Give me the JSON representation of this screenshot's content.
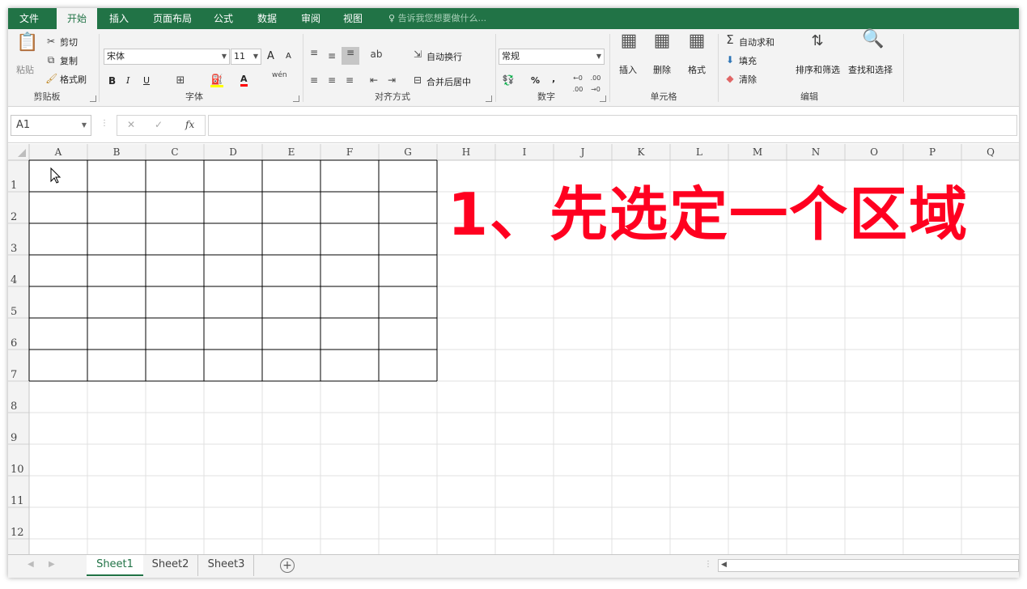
{
  "menu": {
    "tabs": [
      "文件",
      "开始",
      "插入",
      "页面布局",
      "公式",
      "数据",
      "审阅",
      "视图"
    ],
    "active": "开始",
    "tell_me": "告诉我您想要做什么..."
  },
  "ribbon": {
    "clipboard": {
      "paste": "粘贴",
      "cut": "剪切",
      "copy": "复制",
      "format_painter": "格式刷",
      "label": "剪贴板"
    },
    "font": {
      "name": "宋体",
      "size": "11",
      "bold": "B",
      "italic": "I",
      "underline": "U",
      "grow": "A",
      "shrink": "A",
      "font_color": "A",
      "phonetic": "wén",
      "label": "字体"
    },
    "alignment": {
      "wrap": "自动换行",
      "merge": "合并后居中",
      "label": "对齐方式"
    },
    "number": {
      "format": "常规",
      "percent": "%",
      "comma": ",",
      "label": "数字"
    },
    "cells": {
      "insert": "插入",
      "delete": "删除",
      "format": "格式",
      "label": "单元格"
    },
    "editing": {
      "autosum": "自动求和",
      "fill": "填充",
      "clear": "清除",
      "sort": "排序和筛选",
      "find": "查找和选择",
      "label": "编辑"
    }
  },
  "formula_bar": {
    "name_box": "A1",
    "cancel": "✕",
    "enter": "✓",
    "fx": "fx",
    "value": ""
  },
  "grid": {
    "columns": [
      "A",
      "B",
      "C",
      "D",
      "E",
      "F",
      "G",
      "H",
      "I",
      "J",
      "K",
      "L",
      "M",
      "N",
      "O",
      "P",
      "Q"
    ],
    "rows": [
      "1",
      "2",
      "3",
      "4",
      "5",
      "6",
      "7",
      "8",
      "9",
      "10",
      "11",
      "12"
    ],
    "bordered_range": "A1:G7"
  },
  "overlay_text": "1、先选定一个区域",
  "sheets": {
    "tabs": [
      "Sheet1",
      "Sheet2",
      "Sheet3"
    ],
    "active": "Sheet1",
    "add": "+"
  },
  "colors": {
    "accent": "#217346",
    "overlay": "#ff0020"
  }
}
